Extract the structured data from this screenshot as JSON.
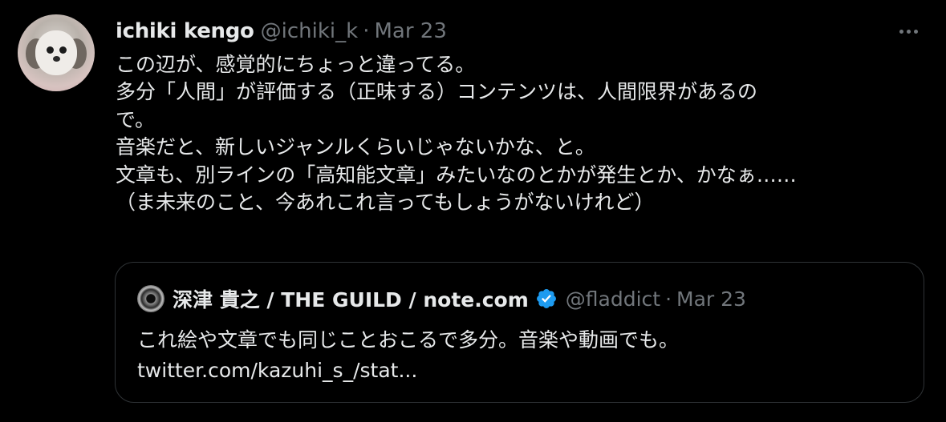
{
  "tweet": {
    "display_name": "ichiki kengo",
    "handle": "@ichiki_k",
    "separator": "·",
    "date": "Mar 23",
    "lines": [
      "この辺が、感覚的にちょっと違ってる。",
      "多分「人間」が評価する（正味する）コンテンツは、人間限界があるの",
      "で。",
      "音楽だと、新しいジャンルくらいじゃないかな、と。",
      "文章も、別ラインの「高知能文章」みたいなのとかが発生とか、かなぁ……",
      "（ま未来のこと、今あれこれ言ってもしょうがないけれど）"
    ]
  },
  "quoted_tweet": {
    "display_name": "深津 貴之 / THE GUILD / note.com",
    "handle": "@fladdict",
    "separator": "·",
    "date": "Mar 23",
    "text": "これ絵や文章でも同じことおこるで多分。音楽や動画でも。",
    "link": "twitter.com/kazuhi_s_/stat..."
  },
  "icons": {
    "more": "more-horizontal-icon",
    "verified": "verified-badge-icon",
    "verified_color": "#1d9bf0"
  }
}
